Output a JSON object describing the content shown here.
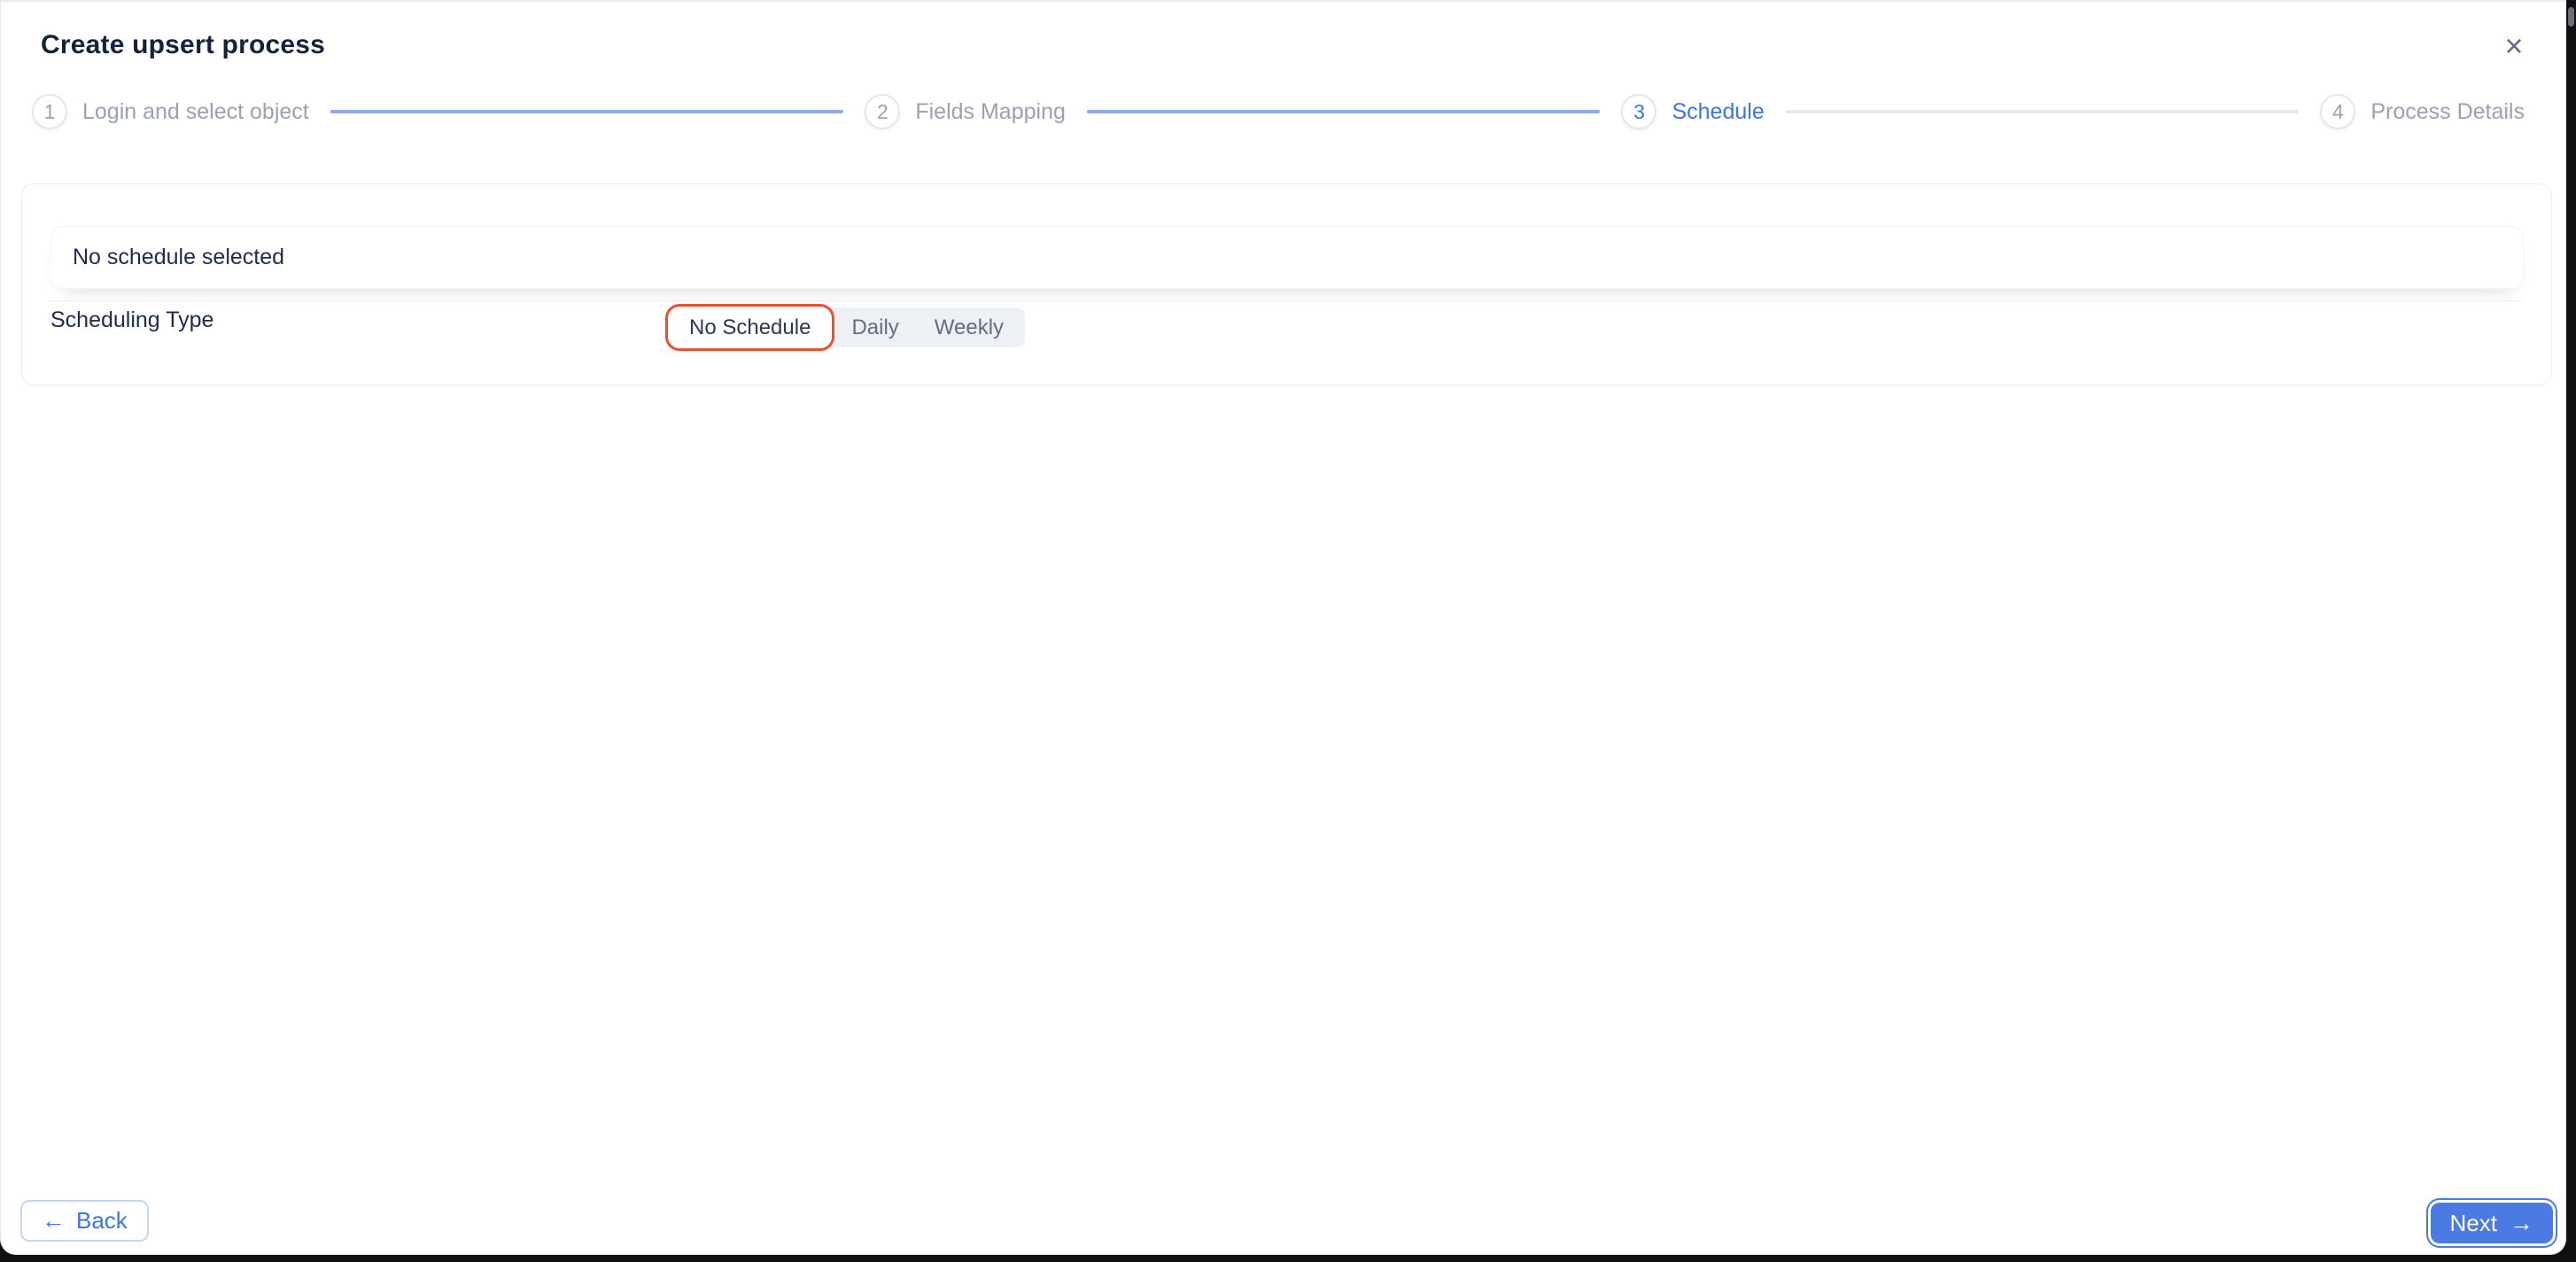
{
  "modal": {
    "title": "Create upsert process",
    "close_icon": "×"
  },
  "stepper": {
    "steps": [
      {
        "number": "1",
        "label": "Login and select object",
        "state": "inactive"
      },
      {
        "number": "2",
        "label": "Fields Mapping",
        "state": "inactive"
      },
      {
        "number": "3",
        "label": "Schedule",
        "state": "active"
      },
      {
        "number": "4",
        "label": "Process Details",
        "state": "inactive"
      }
    ]
  },
  "content": {
    "empty_message": "No schedule selected",
    "scheduling_type_label": "Scheduling Type",
    "scheduling_options": [
      {
        "label": "No Schedule",
        "selected": true
      },
      {
        "label": "Daily",
        "selected": false
      },
      {
        "label": "Weekly",
        "selected": false
      }
    ]
  },
  "footer": {
    "back_icon": "←",
    "back_label": "Back",
    "next_label": "Next",
    "next_icon": "→"
  },
  "colors": {
    "accent_blue": "#3d73e9",
    "button_blue": "#4a7ae2",
    "connector_blue": "#8aabf0",
    "connector_gray": "#e5e9ed",
    "selected_ring_red": "#e8502e",
    "heading_navy": "#16213e",
    "body_navy": "#1f2b4d",
    "muted_gray": "#98a2b3",
    "backdrop_dark": "#0f1012"
  }
}
